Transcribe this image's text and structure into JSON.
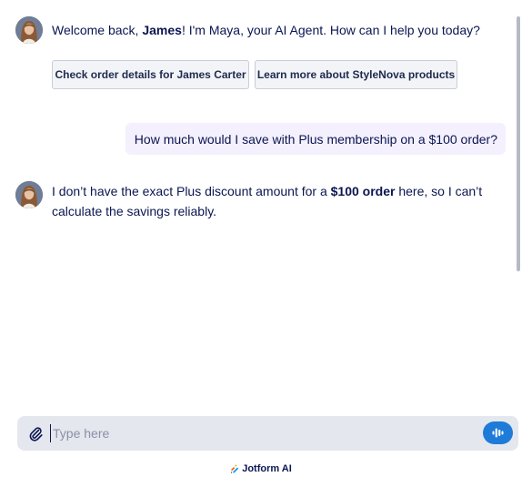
{
  "agent": {
    "name": "Maya",
    "avatar_icon": "agent-avatar-icon"
  },
  "messages": {
    "welcome": {
      "part1": "Welcome back, ",
      "user_name": "James",
      "part2": "! I'm Maya, your AI Agent. How can I help you today?"
    },
    "suggestions": [
      {
        "label": "Check order details for James Carter"
      },
      {
        "label": "Learn more about StyleNova products"
      }
    ],
    "user": {
      "text": "How much would I save with Plus membership on a $100 order?"
    },
    "reply": {
      "part1": "I don’t have the exact Plus discount amount for a ",
      "bold": "$100 order",
      "part2": " here, so I can’t",
      "line2": "calculate the savings reliably."
    }
  },
  "composer": {
    "placeholder": "Type here",
    "attach_icon": "paperclip-icon",
    "voice_icon": "voice-wave-icon"
  },
  "footer": {
    "brand": "Jotform AI",
    "logo_icon": "jotform-logo-icon"
  },
  "colors": {
    "accent": "#1e7bd8",
    "text": "#0a1551",
    "user_bubble": "#f4f0fd",
    "composer_bg": "#e5e7ee"
  }
}
